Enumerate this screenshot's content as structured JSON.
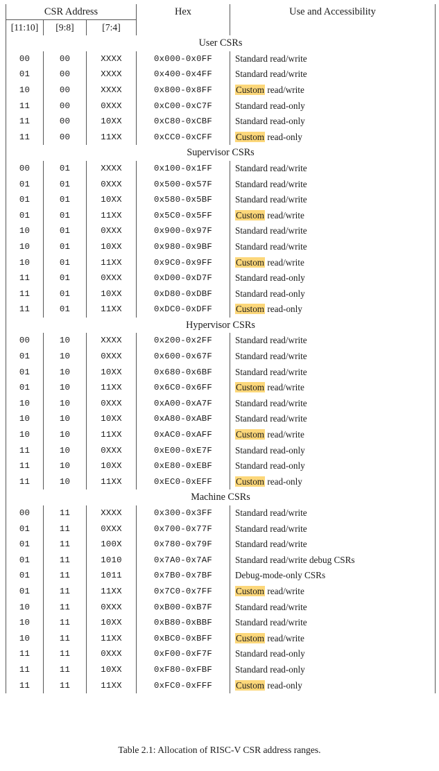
{
  "table": {
    "headers": {
      "group_address": "CSR Address",
      "hex": "Hex",
      "use": "Use and Accessibility",
      "bits_11_10": "[11:10]",
      "bits_9_8": "[9:8]",
      "bits_7_4": "[7:4]"
    },
    "sections": [
      {
        "title": "User CSRs",
        "rows": [
          {
            "bits_11_10": "00",
            "bits_9_8": "00",
            "bits_7_4": "XXXX",
            "hex": "0x000-0x0FF",
            "custom": false,
            "use": "Standard read/write"
          },
          {
            "bits_11_10": "01",
            "bits_9_8": "00",
            "bits_7_4": "XXXX",
            "hex": "0x400-0x4FF",
            "custom": false,
            "use": "Standard read/write"
          },
          {
            "bits_11_10": "10",
            "bits_9_8": "00",
            "bits_7_4": "XXXX",
            "hex": "0x800-0x8FF",
            "custom": true,
            "custom_label": "Custom",
            "use": " read/write"
          },
          {
            "bits_11_10": "11",
            "bits_9_8": "00",
            "bits_7_4": "0XXX",
            "hex": "0xC00-0xC7F",
            "custom": false,
            "use": "Standard read-only"
          },
          {
            "bits_11_10": "11",
            "bits_9_8": "00",
            "bits_7_4": "10XX",
            "hex": "0xC80-0xCBF",
            "custom": false,
            "use": "Standard read-only"
          },
          {
            "bits_11_10": "11",
            "bits_9_8": "00",
            "bits_7_4": "11XX",
            "hex": "0xCC0-0xCFF",
            "custom": true,
            "custom_label": "Custom",
            "use": " read-only"
          }
        ]
      },
      {
        "title": "Supervisor CSRs",
        "rows": [
          {
            "bits_11_10": "00",
            "bits_9_8": "01",
            "bits_7_4": "XXXX",
            "hex": "0x100-0x1FF",
            "custom": false,
            "use": "Standard read/write"
          },
          {
            "bits_11_10": "01",
            "bits_9_8": "01",
            "bits_7_4": "0XXX",
            "hex": "0x500-0x57F",
            "custom": false,
            "use": "Standard read/write"
          },
          {
            "bits_11_10": "01",
            "bits_9_8": "01",
            "bits_7_4": "10XX",
            "hex": "0x580-0x5BF",
            "custom": false,
            "use": "Standard read/write"
          },
          {
            "bits_11_10": "01",
            "bits_9_8": "01",
            "bits_7_4": "11XX",
            "hex": "0x5C0-0x5FF",
            "custom": true,
            "custom_label": "Custom",
            "use": " read/write"
          },
          {
            "bits_11_10": "10",
            "bits_9_8": "01",
            "bits_7_4": "0XXX",
            "hex": "0x900-0x97F",
            "custom": false,
            "use": "Standard read/write"
          },
          {
            "bits_11_10": "10",
            "bits_9_8": "01",
            "bits_7_4": "10XX",
            "hex": "0x980-0x9BF",
            "custom": false,
            "use": "Standard read/write"
          },
          {
            "bits_11_10": "10",
            "bits_9_8": "01",
            "bits_7_4": "11XX",
            "hex": "0x9C0-0x9FF",
            "custom": true,
            "custom_label": "Custom",
            "use": " read/write"
          },
          {
            "bits_11_10": "11",
            "bits_9_8": "01",
            "bits_7_4": "0XXX",
            "hex": "0xD00-0xD7F",
            "custom": false,
            "use": "Standard read-only"
          },
          {
            "bits_11_10": "11",
            "bits_9_8": "01",
            "bits_7_4": "10XX",
            "hex": "0xD80-0xDBF",
            "custom": false,
            "use": "Standard read-only"
          },
          {
            "bits_11_10": "11",
            "bits_9_8": "01",
            "bits_7_4": "11XX",
            "hex": "0xDC0-0xDFF",
            "custom": true,
            "custom_label": "Custom",
            "use": " read-only"
          }
        ]
      },
      {
        "title": "Hypervisor CSRs",
        "rows": [
          {
            "bits_11_10": "00",
            "bits_9_8": "10",
            "bits_7_4": "XXXX",
            "hex": "0x200-0x2FF",
            "custom": false,
            "use": "Standard read/write"
          },
          {
            "bits_11_10": "01",
            "bits_9_8": "10",
            "bits_7_4": "0XXX",
            "hex": "0x600-0x67F",
            "custom": false,
            "use": "Standard read/write"
          },
          {
            "bits_11_10": "01",
            "bits_9_8": "10",
            "bits_7_4": "10XX",
            "hex": "0x680-0x6BF",
            "custom": false,
            "use": "Standard read/write"
          },
          {
            "bits_11_10": "01",
            "bits_9_8": "10",
            "bits_7_4": "11XX",
            "hex": "0x6C0-0x6FF",
            "custom": true,
            "custom_label": "Custom",
            "use": " read/write"
          },
          {
            "bits_11_10": "10",
            "bits_9_8": "10",
            "bits_7_4": "0XXX",
            "hex": "0xA00-0xA7F",
            "custom": false,
            "use": "Standard read/write"
          },
          {
            "bits_11_10": "10",
            "bits_9_8": "10",
            "bits_7_4": "10XX",
            "hex": "0xA80-0xABF",
            "custom": false,
            "use": "Standard read/write"
          },
          {
            "bits_11_10": "10",
            "bits_9_8": "10",
            "bits_7_4": "11XX",
            "hex": "0xAC0-0xAFF",
            "custom": true,
            "custom_label": "Custom",
            "use": " read/write"
          },
          {
            "bits_11_10": "11",
            "bits_9_8": "10",
            "bits_7_4": "0XXX",
            "hex": "0xE00-0xE7F",
            "custom": false,
            "use": "Standard read-only"
          },
          {
            "bits_11_10": "11",
            "bits_9_8": "10",
            "bits_7_4": "10XX",
            "hex": "0xE80-0xEBF",
            "custom": false,
            "use": "Standard read-only"
          },
          {
            "bits_11_10": "11",
            "bits_9_8": "10",
            "bits_7_4": "11XX",
            "hex": "0xEC0-0xEFF",
            "custom": true,
            "custom_label": "Custom",
            "use": " read-only"
          }
        ]
      },
      {
        "title": "Machine CSRs",
        "rows": [
          {
            "bits_11_10": "00",
            "bits_9_8": "11",
            "bits_7_4": "XXXX",
            "hex": "0x300-0x3FF",
            "custom": false,
            "use": "Standard read/write"
          },
          {
            "bits_11_10": "01",
            "bits_9_8": "11",
            "bits_7_4": "0XXX",
            "hex": "0x700-0x77F",
            "custom": false,
            "use": "Standard read/write"
          },
          {
            "bits_11_10": "01",
            "bits_9_8": "11",
            "bits_7_4": "100X",
            "hex": "0x780-0x79F",
            "custom": false,
            "use": "Standard read/write"
          },
          {
            "bits_11_10": "01",
            "bits_9_8": "11",
            "bits_7_4": "1010",
            "hex": "0x7A0-0x7AF",
            "custom": false,
            "use": "Standard read/write debug CSRs"
          },
          {
            "bits_11_10": "01",
            "bits_9_8": "11",
            "bits_7_4": "1011",
            "hex": "0x7B0-0x7BF",
            "custom": false,
            "use": "Debug-mode-only CSRs"
          },
          {
            "bits_11_10": "01",
            "bits_9_8": "11",
            "bits_7_4": "11XX",
            "hex": "0x7C0-0x7FF",
            "custom": true,
            "custom_label": "Custom",
            "use": " read/write"
          },
          {
            "bits_11_10": "10",
            "bits_9_8": "11",
            "bits_7_4": "0XXX",
            "hex": "0xB00-0xB7F",
            "custom": false,
            "use": "Standard read/write"
          },
          {
            "bits_11_10": "10",
            "bits_9_8": "11",
            "bits_7_4": "10XX",
            "hex": "0xB80-0xBBF",
            "custom": false,
            "use": "Standard read/write"
          },
          {
            "bits_11_10": "10",
            "bits_9_8": "11",
            "bits_7_4": "11XX",
            "hex": "0xBC0-0xBFF",
            "custom": true,
            "custom_label": "Custom",
            "use": " read/write"
          },
          {
            "bits_11_10": "11",
            "bits_9_8": "11",
            "bits_7_4": "0XXX",
            "hex": "0xF00-0xF7F",
            "custom": false,
            "use": "Standard read-only"
          },
          {
            "bits_11_10": "11",
            "bits_9_8": "11",
            "bits_7_4": "10XX",
            "hex": "0xF80-0xFBF",
            "custom": false,
            "use": "Standard read-only"
          },
          {
            "bits_11_10": "11",
            "bits_9_8": "11",
            "bits_7_4": "11XX",
            "hex": "0xFC0-0xFFF",
            "custom": true,
            "custom_label": "Custom",
            "use": " read-only"
          }
        ]
      }
    ]
  },
  "caption": "Table 2.1: Allocation of RISC-V CSR address ranges.",
  "colors": {
    "highlight": "#fcd77a",
    "rule": "#555555",
    "text": "#1a1a1a"
  }
}
